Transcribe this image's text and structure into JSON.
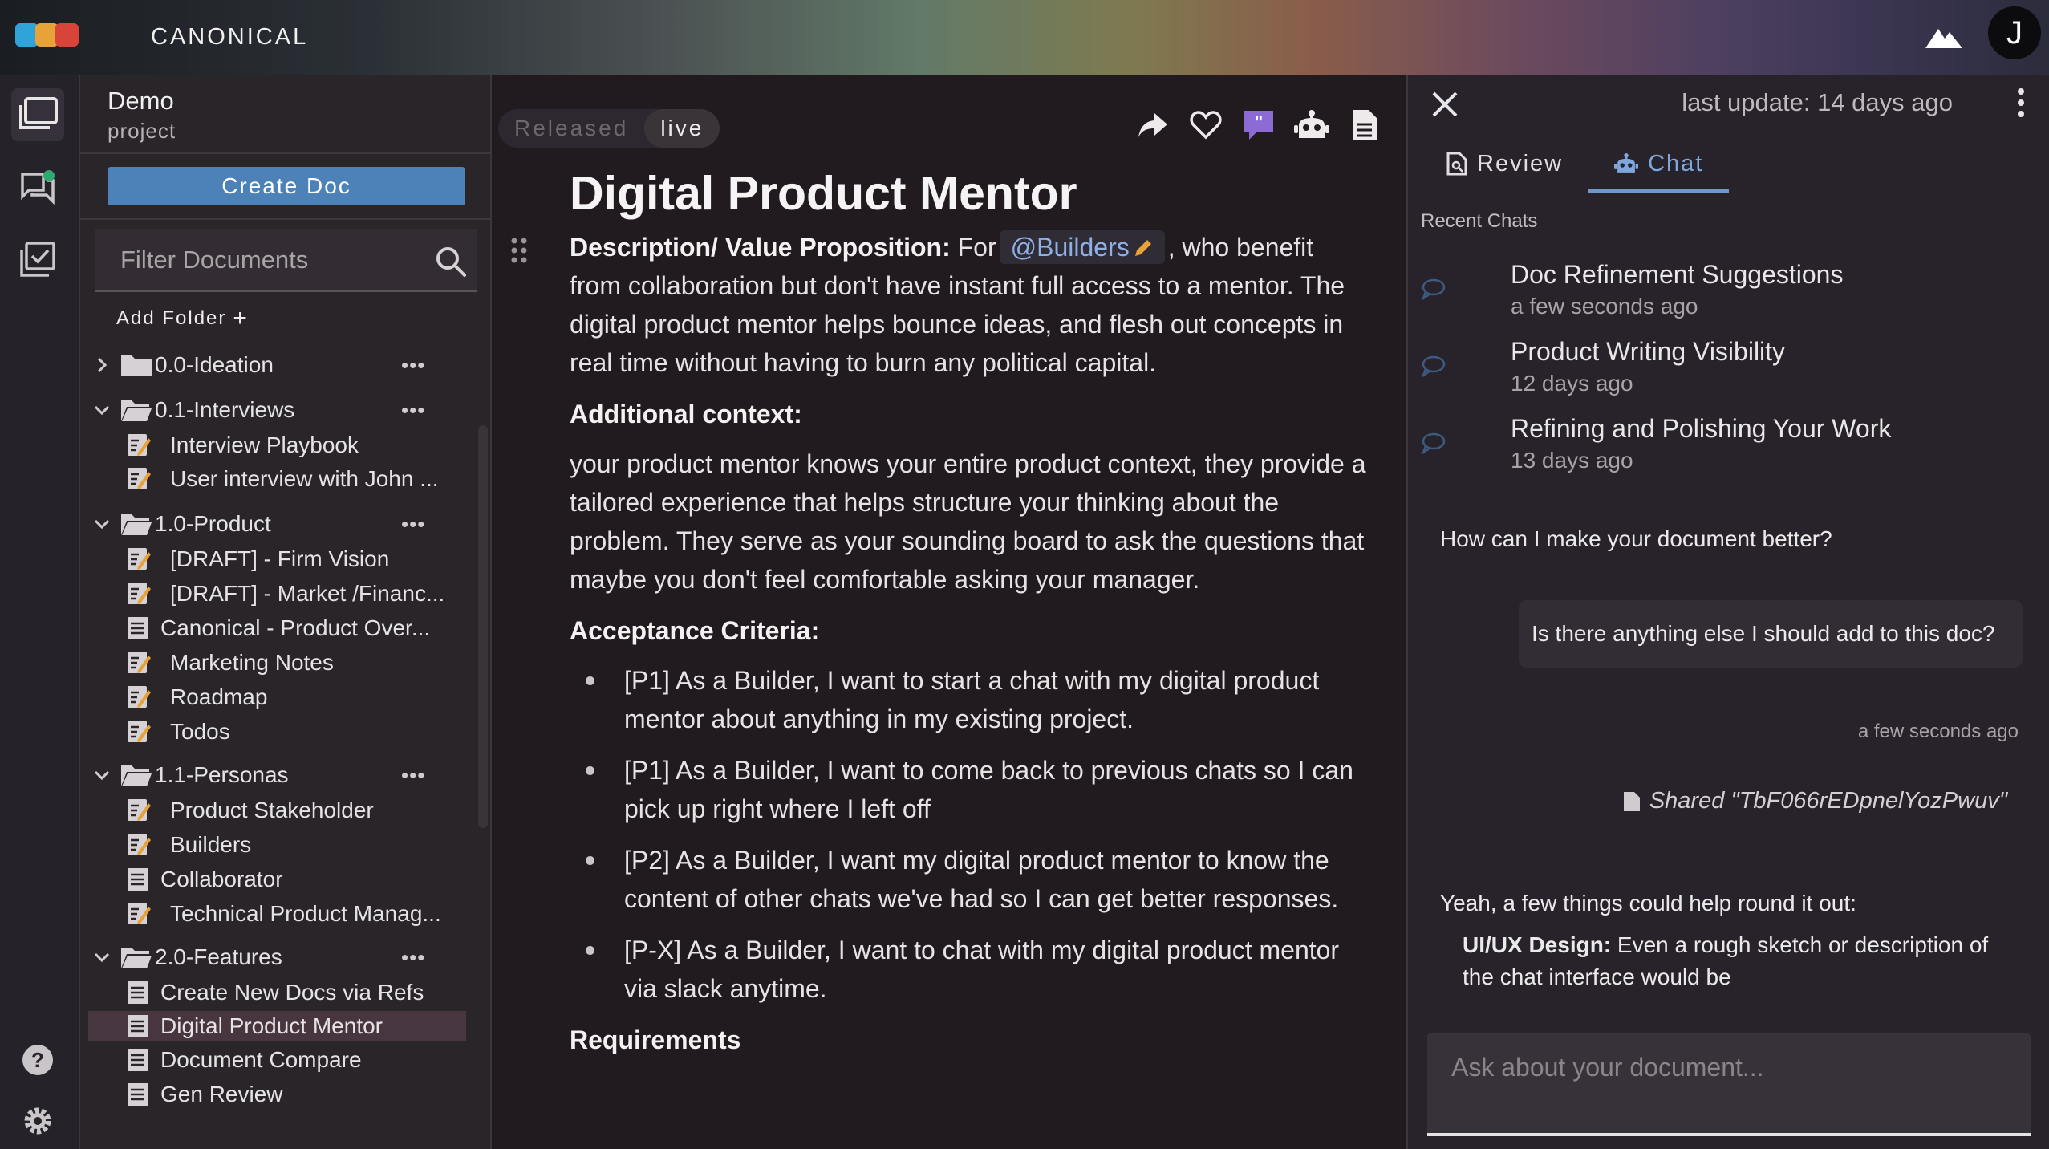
{
  "app": {
    "brand": "CANONICAL",
    "user_initial": "J",
    "brand_colors": [
      "#2fa4d8",
      "#e8a23a",
      "#d8433a"
    ]
  },
  "project": {
    "name": "Demo",
    "subtitle": "project",
    "create_doc_label": "Create Doc",
    "filter_placeholder": "Filter Documents",
    "add_folder_label": "Add Folder"
  },
  "tree": {
    "folders": [
      {
        "label": "0.0-Ideation",
        "expanded": false
      },
      {
        "label": "0.1-Interviews",
        "expanded": true,
        "docs": [
          "Interview Playbook",
          "User interview with John ..."
        ]
      },
      {
        "label": "1.0-Product",
        "expanded": true,
        "docs": [
          "[DRAFT] - Firm Vision",
          "[DRAFT] - Market /Financ...",
          "Canonical - Product Over...",
          "Marketing Notes",
          "Roadmap",
          "Todos"
        ]
      },
      {
        "label": "1.1-Personas",
        "expanded": true,
        "docs": [
          "Product Stakeholder",
          "Builders",
          "Collaborator",
          "Technical Product Manag..."
        ]
      },
      {
        "label": "2.0-Features",
        "expanded": true,
        "docs": [
          "Create New Docs via Refs",
          "Digital Product Mentor",
          "Document Compare",
          "Gen Review"
        ]
      }
    ],
    "selected": "Digital Product Mentor"
  },
  "document": {
    "status_released": "Released",
    "status_live": "live",
    "title": "Digital Product Mentor",
    "desc_label": "Description/ Value Proposition:",
    "desc_pre": "For",
    "mention": "@Builders",
    "desc_post": ", who benefit from collaboration but don't have instant full access to a mentor. The digital product mentor helps bounce ideas, and flesh out concepts in real time without having to burn any political capital.",
    "context_heading": "Additional context:",
    "context_text": "your product mentor knows your entire product context, they provide a tailored experience that helps structure your thinking about the problem. They serve as your sounding board to ask the questions that maybe you don't feel comfortable asking your manager.",
    "criteria_heading": "Acceptance Criteria:",
    "criteria": [
      "[P1] As a Builder, I want to start a chat with my digital product mentor about anything in my existing project.",
      "[P1] As a Builder, I want to come back to previous chats so I can pick up right where I left off",
      "[P2] As a Builder, I want my digital product mentor to know the content of other chats we've had so I can get better responses.",
      "[P-X] As a Builder, I want to chat with my digital product mentor via slack anytime."
    ],
    "requirements_heading": "Requirements"
  },
  "chat": {
    "last_update": "last update: 14 days ago",
    "tab_review": "Review",
    "tab_chat": "Chat",
    "recent_heading": "Recent Chats",
    "recent": [
      {
        "title": "Doc Refinement Suggestions",
        "time": "a few seconds ago"
      },
      {
        "title": "Product Writing Visibility",
        "time": "12 days ago"
      },
      {
        "title": "Refining and Polishing Your Work",
        "time": "13 days ago"
      }
    ],
    "bot_prompt": "How can I make your document better?",
    "user_message": "Is there anything else I should add to this doc?",
    "user_message_time": "a few seconds ago",
    "shared": "Shared \"TbF066rEDpnelYozPwuv\"",
    "answer_intro": "Yeah, a few things could help round it out:",
    "answer_bold": "UI/UX Design:",
    "answer_rest": " Even a rough sketch or description of the chat interface would be",
    "input_placeholder": "Ask about your document..."
  }
}
